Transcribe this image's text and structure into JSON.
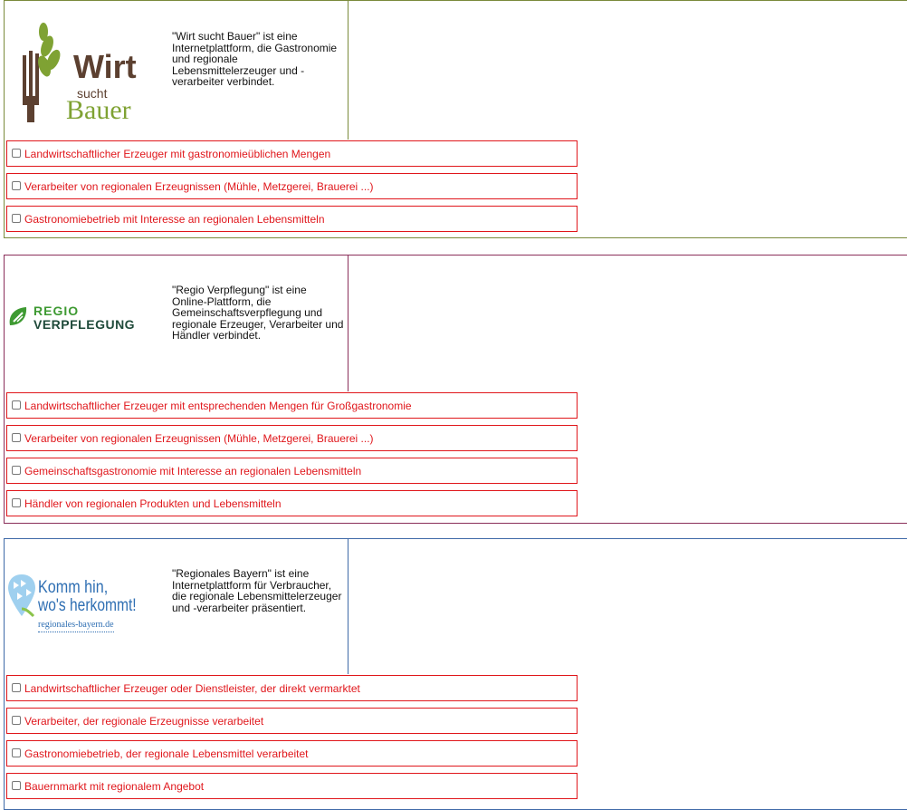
{
  "sections": [
    {
      "description": "\"Wirt sucht Bauer\" ist eine Internetplattform, die Gastronomie und regionale Lebensmittelerzeuger und -verarbeiter verbindet.",
      "logo": {
        "line1": "Wirt",
        "line2": "sucht",
        "line3": "Bauer"
      },
      "border_color": "#7a8a3b",
      "options": [
        "Landwirtschaftlicher Erzeuger mit gastronomieüblichen Mengen",
        "Verarbeiter von regionalen Erzeugnissen (Mühle, Metzgerei, Brauerei ...)",
        "Gastronomiebetrieb mit Interesse an regionalen Lebensmitteln"
      ]
    },
    {
      "description": "\"Regio Verpflegung\" ist eine Online-Plattform, die Gemeinschaftsverpflegung und regionale Erzeuger, Verarbeiter und Händler verbindet.",
      "logo": {
        "line1": "REGIO",
        "line2": "VERPFLEGUNG"
      },
      "border_color": "#8a2f5a",
      "options": [
        "Landwirtschaftlicher Erzeuger mit entsprechenden Mengen für Großgastronomie",
        "Verarbeiter von regionalen Erzeugnissen (Mühle, Metzgerei, Brauerei ...)",
        "Gemeinschaftsgastronomie mit Interesse an regionalen Lebensmitteln",
        "Händler von regionalen Produkten und Lebensmitteln"
      ]
    },
    {
      "description": "\"Regionales Bayern\" ist eine Internetplattform für Verbraucher, die regionale Lebensmittelerzeuger und -verarbeiter präsentiert.",
      "logo": {
        "line1": "Komm hin,",
        "line2": "wo's herkommt!",
        "line3": "regionales-bayern.de"
      },
      "border_color": "#3f6aa8",
      "options": [
        "Landwirtschaftlicher Erzeuger oder Dienstleister, der direkt vermarktet",
        "Verarbeiter, der regionale Erzeugnisse verarbeitet",
        "Gastronomiebetrieb, der regionale Lebensmittel verarbeitet",
        "Bauernmarkt mit regionalem Angebot"
      ]
    }
  ],
  "colors": {
    "option_red": "#e0161b",
    "wirt_brown": "#5c4030",
    "wirt_green": "#7fa233",
    "regio_green": "#3e9a32",
    "regio_dark": "#1f4a3a",
    "bayern_blue": "#2f6fb3"
  }
}
